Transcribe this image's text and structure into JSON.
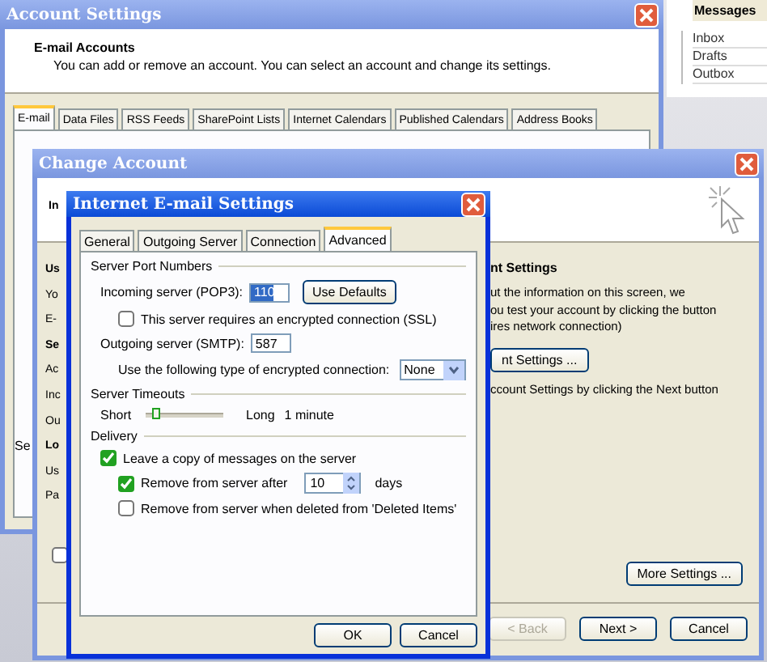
{
  "messages_pane": {
    "title": "Messages",
    "folders": [
      "Inbox",
      "Drafts",
      "Outbox"
    ]
  },
  "account_settings": {
    "title": "Account Settings",
    "heading": "E-mail Accounts",
    "description": "You can add or remove an account. You can select an account and change its settings.",
    "tabs": [
      {
        "label": "E-mail",
        "selected": true
      },
      {
        "label": "Data Files",
        "selected": false
      },
      {
        "label": "RSS Feeds",
        "selected": false
      },
      {
        "label": "SharePoint Lists",
        "selected": false
      },
      {
        "label": "Internet Calendars",
        "selected": false
      },
      {
        "label": "Published Calendars",
        "selected": false
      },
      {
        "label": "Address Books",
        "selected": false
      }
    ],
    "fragment": "Se"
  },
  "change_account": {
    "title": "Change Account",
    "left_fragments": [
      {
        "text": "In",
        "bold": true
      },
      {
        "text": "Us",
        "bold": true
      },
      {
        "text": "Yo",
        "bold": false
      },
      {
        "text": "E-",
        "bold": false
      },
      {
        "text": "Se",
        "bold": true
      },
      {
        "text": "Ac",
        "bold": false
      },
      {
        "text": "Inc",
        "bold": false
      },
      {
        "text": "Ou",
        "bold": false
      },
      {
        "text": "Lo",
        "bold": true
      },
      {
        "text": "Us",
        "bold": false
      },
      {
        "text": "Pa",
        "bold": false
      }
    ],
    "section_heading": "nt Settings",
    "info_lines": [
      "ut the information on this screen, we",
      "ou test your account by clicking the button",
      "ires network connection)"
    ],
    "test_button": "nt Settings ...",
    "next_hint": "ccount Settings by clicking the Next button",
    "checkbox": {
      "checked": false
    },
    "more_settings_button": "More Settings ...",
    "buttons": [
      {
        "label": "< Back",
        "disabled": true
      },
      {
        "label": "Next >",
        "disabled": false
      },
      {
        "label": "Cancel",
        "disabled": false
      }
    ]
  },
  "email_settings": {
    "title": "Internet E-mail Settings",
    "tabs": [
      {
        "label": "General",
        "selected": false
      },
      {
        "label": "Outgoing Server",
        "selected": false
      },
      {
        "label": "Connection",
        "selected": false
      },
      {
        "label": "Advanced",
        "selected": true
      }
    ],
    "port_group": "Server Port Numbers",
    "incoming_label": "Incoming server (POP3):",
    "incoming_value": "110",
    "use_defaults": "Use Defaults",
    "ssl": {
      "label": "This server requires an encrypted connection (SSL)",
      "checked": false
    },
    "outgoing_label": "Outgoing server (SMTP):",
    "outgoing_value": "587",
    "encryption_label": "Use the following type of encrypted connection:",
    "encryption_value": "None",
    "timeouts_group": "Server Timeouts",
    "timeout": {
      "short": "Short",
      "long": "Long",
      "reading": "1 minute",
      "level": 0.08
    },
    "delivery_group": "Delivery",
    "leave_copy": {
      "label": "Leave a copy of messages on the server",
      "checked": true
    },
    "remove_after": {
      "label": "Remove from server after",
      "checked": true,
      "value": "10",
      "unit": "days"
    },
    "remove_deleted": {
      "label": "Remove from server when deleted from 'Deleted Items'",
      "checked": false
    },
    "buttons": [
      "OK",
      "Cancel"
    ]
  }
}
